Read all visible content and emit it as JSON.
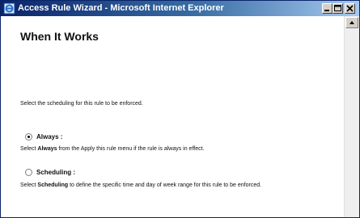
{
  "window": {
    "title": "Access Rule Wizard - Microsoft Internet Explorer",
    "controls": {
      "minimize": "_",
      "maximize": "□",
      "close": "×"
    }
  },
  "page": {
    "heading": "When It Works",
    "intro": "Select the scheduling for this rule to be enforced.",
    "options": [
      {
        "label": "Always :",
        "selected": true,
        "desc_prefix": "Select ",
        "desc_bold": "Always",
        "desc_suffix": " from the Apply this rule menu if the rule is always in effect."
      },
      {
        "label": "Scheduling :",
        "selected": false,
        "desc_prefix": "Select ",
        "desc_bold": "Scheduling",
        "desc_suffix": " to define the specific time and day of week range for this rule to be enforced."
      }
    ]
  },
  "colors": {
    "titlebar_start": "#0a246a",
    "titlebar_end": "#a6caf0",
    "button_face": "#d4d0c8"
  },
  "icons": [
    "ie-window-icon",
    "minimize-icon",
    "maximize-icon",
    "close-icon",
    "scroll-up-arrow-icon"
  ]
}
